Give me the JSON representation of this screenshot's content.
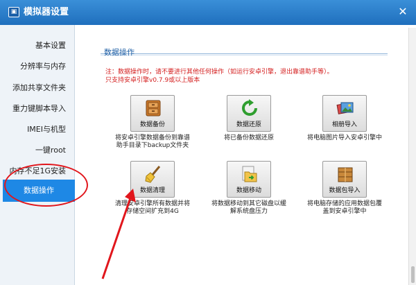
{
  "window": {
    "title": "模拟器设置",
    "close_symbol": "✕"
  },
  "sidebar": {
    "items": [
      {
        "label": "基本设置"
      },
      {
        "label": "分辨率与内存"
      },
      {
        "label": "添加共享文件夹"
      },
      {
        "label": "重力键脚本导入"
      },
      {
        "label": "IMEI与机型"
      },
      {
        "label": "一键root"
      },
      {
        "label": "内存不足1G安装"
      },
      {
        "label": "数据操作",
        "active": true
      }
    ]
  },
  "main": {
    "section_title": "数据操作",
    "notice_line1": "注：数据操作时，请不要进行其他任何操作（如运行安卓引擎，退出靠谱助手等）。",
    "notice_line2": "只支持安卓引擎v0.7.9或以上版本",
    "operations": [
      {
        "label": "数据备份",
        "icon": "cabinet-icon",
        "desc": "将安卓引擎数据备份到靠谱\n助手目录下backup文件夹"
      },
      {
        "label": "数据还原",
        "icon": "restore-arrow-icon",
        "desc": "将已备份数据还原"
      },
      {
        "label": "相册导入",
        "icon": "photo-album-icon",
        "desc": "将电脑图片导入安卓引擎中"
      },
      {
        "label": "数据清理",
        "icon": "broom-icon",
        "desc": "清理安卓引擎所有数据并将\n存储空间扩充到4G"
      },
      {
        "label": "数据移动",
        "icon": "folder-move-icon",
        "desc": "将数据移动到其它磁盘以缓\n解系统盘压力"
      },
      {
        "label": "数据包导入",
        "icon": "package-box-icon",
        "desc": "将电脑存储的应用数据包覆\n盖到安卓引擎中"
      }
    ]
  },
  "colors": {
    "titlebar": "#2b7fcf",
    "active_item": "#1e88e5",
    "annotation_red": "#e1161c",
    "notice_red": "#d42020"
  }
}
